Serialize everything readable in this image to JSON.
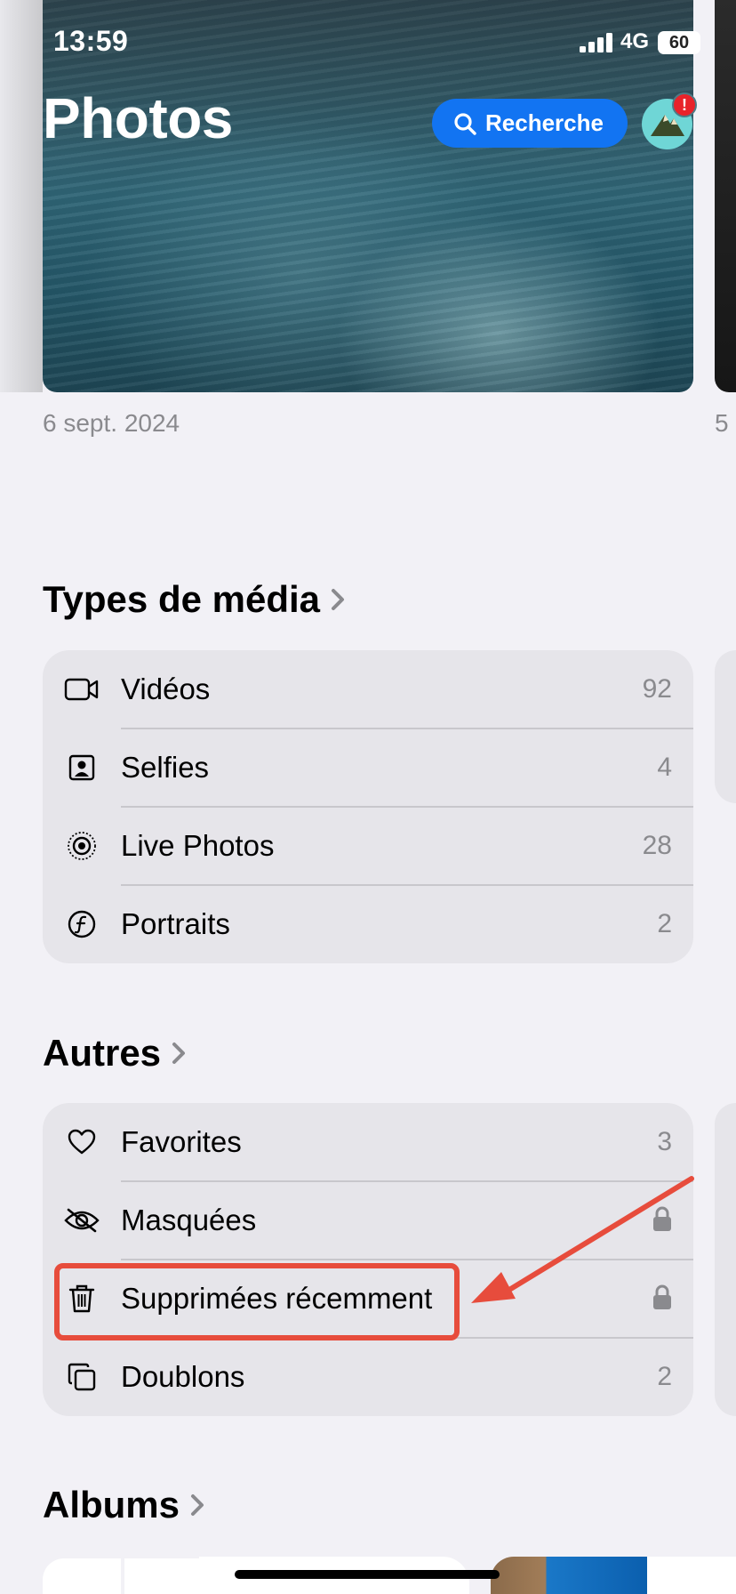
{
  "status_bar": {
    "time": "13:59",
    "network": "4G",
    "battery": "60"
  },
  "header": {
    "title": "Photos",
    "search_label": "Recherche",
    "avatar_badge": "!"
  },
  "featured": {
    "date": "6 sept. 2024",
    "next_date": "5"
  },
  "media_types": {
    "title": "Types de média",
    "items": [
      {
        "icon": "video-icon",
        "label": "Vidéos",
        "count": "92"
      },
      {
        "icon": "selfie-icon",
        "label": "Selfies",
        "count": "4"
      },
      {
        "icon": "live-photo-icon",
        "label": "Live Photos",
        "count": "28"
      },
      {
        "icon": "portrait-icon",
        "label": "Portraits",
        "count": "2"
      }
    ]
  },
  "others": {
    "title": "Autres",
    "items": [
      {
        "icon": "heart-icon",
        "label": "Favorites",
        "count": "3"
      },
      {
        "icon": "eye-slash-icon",
        "label": "Masquées",
        "locked": true
      },
      {
        "icon": "trash-icon",
        "label": "Supprimées récemment",
        "locked": true
      },
      {
        "icon": "duplicate-icon",
        "label": "Doublons",
        "count": "2"
      }
    ]
  },
  "albums": {
    "title": "Albums"
  },
  "annotation": {
    "color": "#e74c3c",
    "target": "Supprimées récemment"
  },
  "colors": {
    "accent": "#1274f2",
    "background": "#f2f1f6",
    "card": "#e6e5ea",
    "secondary_text": "#8a8a8e"
  }
}
